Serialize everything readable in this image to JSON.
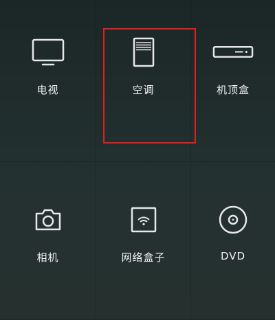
{
  "devices": [
    {
      "id": "tv",
      "label": "电视",
      "icon": "tv-icon"
    },
    {
      "id": "air-conditioner",
      "label": "空调",
      "icon": "air-conditioner-icon"
    },
    {
      "id": "set-top-box",
      "label": "机顶盒",
      "icon": "set-top-box-icon"
    },
    {
      "id": "camera",
      "label": "相机",
      "icon": "camera-icon"
    },
    {
      "id": "network-box",
      "label": "网络盒子",
      "icon": "wifi-box-icon"
    },
    {
      "id": "dvd",
      "label": "DVD",
      "icon": "disc-icon"
    }
  ],
  "highlight_color": "#e02020",
  "icon_color": "#e8e8e8"
}
